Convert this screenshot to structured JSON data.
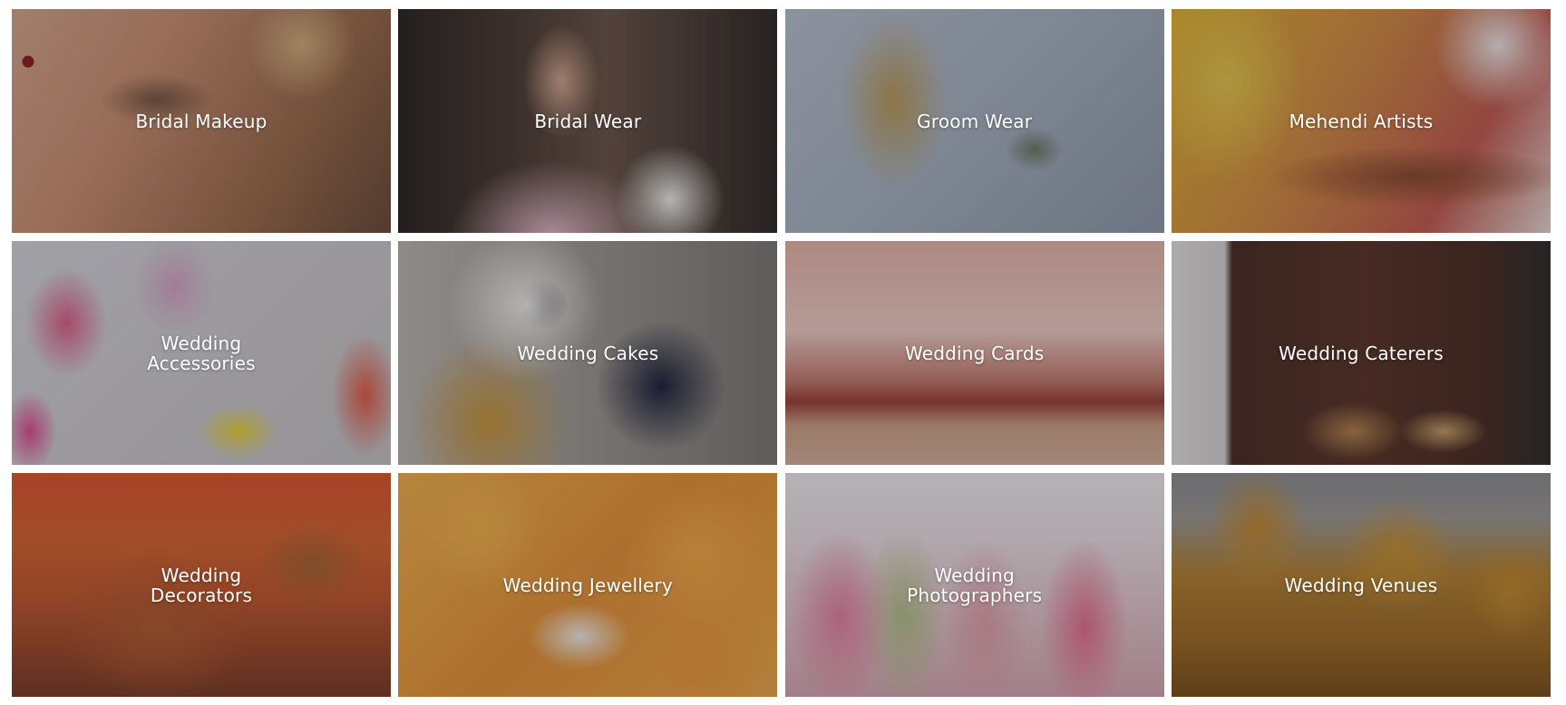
{
  "categories": [
    {
      "label": "Bridal Makeup"
    },
    {
      "label": "Bridal Wear"
    },
    {
      "label": "Groom Wear"
    },
    {
      "label": "Mehendi Artists"
    },
    {
      "label": "Wedding Accessories"
    },
    {
      "label": "Wedding Cakes"
    },
    {
      "label": "Wedding Cards"
    },
    {
      "label": "Wedding Caterers"
    },
    {
      "label": "Wedding Decorators"
    },
    {
      "label": "Wedding Jewellery"
    },
    {
      "label": "Wedding Photographers"
    },
    {
      "label": "Wedding Venues"
    }
  ]
}
